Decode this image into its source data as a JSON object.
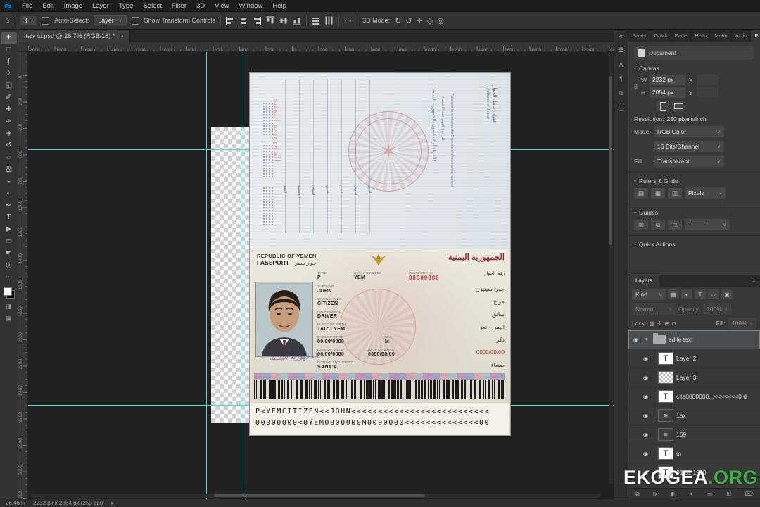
{
  "app": {
    "logo": "Ps",
    "menu": [
      "File",
      "Edit",
      "Image",
      "Layer",
      "Type",
      "Select",
      "Filter",
      "3D",
      "View",
      "Window",
      "Help"
    ]
  },
  "ui": {
    "eye": "◉",
    "select_arrow": "∨",
    "chevron_down": "▾",
    "close": "×",
    "home": "⌂",
    "dots": "⋯",
    "star": "✶",
    "link": "8",
    "panel_menu": "≡",
    "status_arrow": "▸",
    "move_glyph": "✛",
    "collapse": "«"
  },
  "options_bar": {
    "auto_select_label": "Auto-Select:",
    "auto_select_value": "Layer",
    "show_transform_label": "Show Transform Controls",
    "mode_label": "3D Mode:",
    "mode_icons": [
      "↻",
      "↺",
      "✛",
      "◇",
      "◎"
    ]
  },
  "document_tab": {
    "title": "Italy id.psd @ 26.7% (RGB/16) *"
  },
  "rulers": {
    "h": [
      "2000",
      "1800",
      "1600",
      "1400",
      "1200",
      "1000",
      "800",
      "600",
      "400",
      "200",
      "0",
      "200",
      "400",
      "600",
      "800",
      "1000",
      "1200",
      "1400",
      "1600",
      "1800",
      "2000",
      "2200",
      "2400"
    ],
    "v": [
      "0",
      "200",
      "400",
      "600",
      "800",
      "1000",
      "1200",
      "1400",
      "1600",
      "1800",
      "2000",
      "2200",
      "2400",
      "2600",
      "2800",
      "3000",
      "3200"
    ]
  },
  "tools": [
    {
      "name": "move-tool",
      "glyph": "✛"
    },
    {
      "name": "rectangular-marquee-tool",
      "glyph": "□"
    },
    {
      "name": "lasso-tool",
      "glyph": "ʃ"
    },
    {
      "name": "quick-selection-tool",
      "glyph": "✧"
    },
    {
      "name": "crop-tool",
      "glyph": "◱"
    },
    {
      "name": "eyedropper-tool",
      "glyph": "✐"
    },
    {
      "name": "spot-healing-brush-tool",
      "glyph": "✚"
    },
    {
      "name": "brush-tool",
      "glyph": "✑"
    },
    {
      "name": "clone-stamp-tool",
      "glyph": "◈"
    },
    {
      "name": "history-brush-tool",
      "glyph": "↺"
    },
    {
      "name": "eraser-tool",
      "glyph": "▱"
    },
    {
      "name": "gradient-tool",
      "glyph": "▨"
    },
    {
      "name": "blur-tool",
      "glyph": "◒"
    },
    {
      "name": "dodge-tool",
      "glyph": "◐"
    },
    {
      "name": "pen-tool",
      "glyph": "✒"
    },
    {
      "name": "type-tool",
      "glyph": "T"
    },
    {
      "name": "path-selection-tool",
      "glyph": "▶"
    },
    {
      "name": "rectangle-tool",
      "glyph": "▭"
    },
    {
      "name": "hand-tool",
      "glyph": "☛"
    },
    {
      "name": "zoom-tool",
      "glyph": "◎"
    },
    {
      "name": "more-tools",
      "glyph": "⋯"
    }
  ],
  "panel_strip": [
    {
      "name": "collapse-panels-icon",
      "glyph": "«"
    },
    {
      "name": "adjustments-panel-icon",
      "glyph": "☲"
    },
    {
      "name": "character-panel-icon",
      "glyph": "A"
    },
    {
      "name": "paragraph-panel-icon",
      "glyph": "¶"
    },
    {
      "name": "clone-source-panel-icon",
      "glyph": "⧉"
    },
    {
      "name": "libraries-panel-icon",
      "glyph": "◫"
    }
  ],
  "panel_tabs": [
    {
      "label": "Swats"
    },
    {
      "label": "Gradi"
    },
    {
      "label": "Patte"
    },
    {
      "label": "Histo"
    },
    {
      "label": "Motio"
    },
    {
      "label": "Actio"
    },
    {
      "label": "Properties",
      "active": "true"
    }
  ],
  "properties": {
    "context": "Document",
    "canvas_section": "Canvas",
    "w_label": "W",
    "w_value": "2232 px",
    "h_label": "H",
    "h_value": "2854 px",
    "x_label": "X",
    "y_label": "Y",
    "resolution_label": "Resolution:",
    "resolution_value": "250 pixels/inch",
    "mode_label": "Mode",
    "mode_value": "RGB Color",
    "depth_value": "16 Bits/Channel",
    "fill_label": "Fill",
    "fill_value": "Transparent",
    "rulers_grids_section": "Rulers & Grids",
    "units_value": "Pixels",
    "guides_section": "Guides",
    "quick_actions_section": "Quick Actions",
    "rg_icons": [
      "▤",
      "▦",
      "◫"
    ],
    "guide_icons": [
      "▥",
      "⧉",
      "□"
    ]
  },
  "layers_panel": {
    "tab": "Layers",
    "kind_label": "Kind",
    "filter_icons": [
      "▦",
      "◐",
      "T",
      "▱",
      "▣"
    ],
    "blend_value": "Normal",
    "opacity_label": "Opacity:",
    "opacity_value": "100%",
    "lock_label": "Lock:",
    "lock_icons": [
      "▨",
      "✛",
      "⊞",
      "◘"
    ],
    "fill_label": "Fill:",
    "fill_value": "100%",
    "bottom_icons": [
      {
        "name": "link-layers-icon",
        "glyph": "⧉"
      },
      {
        "name": "layer-effects-icon",
        "glyph": "fx"
      },
      {
        "name": "layer-mask-icon",
        "glyph": "◧"
      },
      {
        "name": "adjustment-layer-icon",
        "glyph": "◐"
      },
      {
        "name": "layer-group-icon",
        "glyph": "▭"
      },
      {
        "name": "new-layer-icon",
        "glyph": "⊞"
      },
      {
        "name": "delete-layer-icon",
        "glyph": "⌦"
      }
    ],
    "layers": [
      {
        "name": "edite text",
        "kind": "group",
        "selected": "true",
        "expander": "▾"
      },
      {
        "name": "Layer 2",
        "kind": "text",
        "thumb_glyph": "T"
      },
      {
        "name": "Layer 3",
        "kind": "checker"
      },
      {
        "name": "cita0000000...<<<<<<<0 d",
        "kind": "text",
        "thumb_glyph": "T"
      },
      {
        "name": "1ax",
        "kind": "dark",
        "thumb_glyph": "≋"
      },
      {
        "name": "169",
        "kind": "dark",
        "thumb_glyph": "≋"
      },
      {
        "name": "m",
        "kind": "text",
        "thumb_glyph": "T"
      },
      {
        "name": "01.01.1990",
        "kind": "text",
        "thumb_glyph": "T"
      }
    ]
  },
  "status_bar": {
    "zoom": "26.46%",
    "dims": "2232 px x 2854 px (250 ppi)"
  },
  "watermark": {
    "main": "EKOGEA",
    "suffix": ".ORG"
  },
  "passport": {
    "visa_page": {
      "calligraphy_ar": "الجمهورية اليمنية",
      "form_labels": [
        "الاسم",
        "الجنسية",
        "العنوان",
        "تلفون",
        "الاسم",
        "العنوان",
        "تلفون"
      ],
      "relatives_ar1": "الأقرباء أو المقيمون بالجمهورية اليمنية",
      "relatives_ar2": "للرجوع إليهم عند الاقتضاء",
      "relatives_en": "Relatives to contact in the Republic of Yemen when needed",
      "address_ar": "عنوان حامل الجواز",
      "address_en": "Address of Bearer"
    },
    "data_page": {
      "country_en": "REPUBLIC OF YEMEN",
      "passport_en": "PASSPORT",
      "passport_ar": "جواز سفر",
      "country_ar": "الجمهورية اليمنية",
      "type_label": "TYPE",
      "type_value": "P",
      "country_code_label": "COUNTRY CODE",
      "country_code_value": "YEM",
      "passport_no_label": "PASSPORT No",
      "passport_no_ar": "رقم الجواز",
      "passport_no_value": "00000000",
      "surname_label": "SURNAME",
      "surname_value": "JOHN",
      "surname_ar": "جون سيتيزن",
      "given_label": "GIVEN NAMES",
      "given_value": "CITIZEN",
      "given_ar": "هزاع",
      "profession_label": "PROFESSION",
      "profession_value": "DRIVER",
      "profession_ar": "سائق",
      "pob_label": "PLACE OF BIRTH",
      "pob_value": "TAIZ - YEM",
      "pob_ar": "اليمن - تعز",
      "dob_label": "DATE OF BIRTH",
      "dob_value": "00/00/0000",
      "sex_label": "SEX",
      "sex_value": "M",
      "sex_ar": "ذكر",
      "doi_label": "DATE OF ISSUE",
      "doi_value": "00/00/0000",
      "doe_label": "DATE OF EXPIRY",
      "doe_value": "0000/00/00",
      "expiry_ar_value": "0000/00/00",
      "authority_label": "ISSUING AUTHORITY",
      "authority_value": "SANA'A",
      "authority_ar": "صنعاء",
      "stamp_ar": "الجمهورية اليمنية",
      "mrz1": "P<YEMCITIZEN<<JOHN<<<<<<<<<<<<<<<<<<<<<<<<<<",
      "mrz2": "00000000<0YEM0000000M0000000<<<<<<<<<<<<<<00"
    }
  }
}
